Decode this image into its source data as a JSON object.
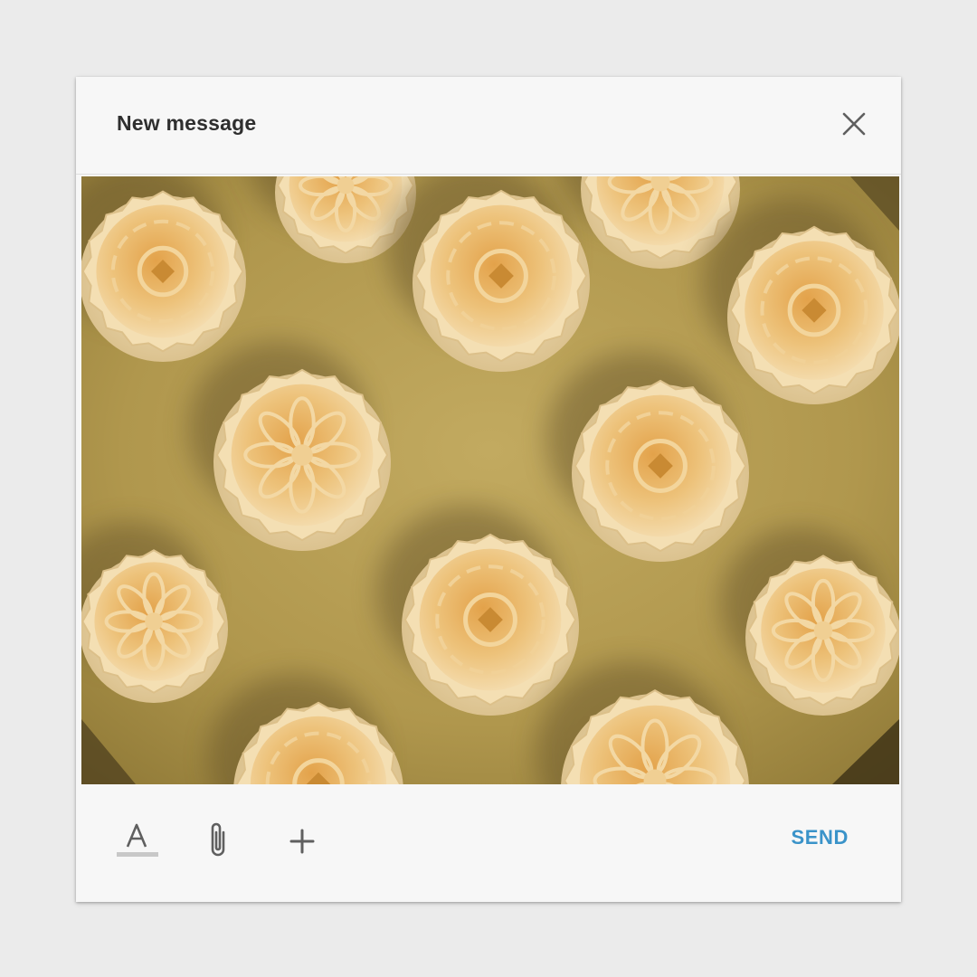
{
  "compose": {
    "title": "New message",
    "close_icon": "close-icon",
    "photo": {
      "subject": "mooncakes on a baking tray",
      "colors": {
        "tray": "#b39a4e",
        "pastry": "#eab867",
        "pastry_edge": "#f5dfb4",
        "shadow": "#5e4d26"
      }
    },
    "toolbar": {
      "format_icon": "text-format-icon",
      "attach_icon": "paperclip-icon",
      "add_icon": "plus-icon",
      "send_label": "SEND"
    },
    "colors": {
      "accent": "#3a93c9",
      "surface": "#f7f7f7",
      "backdrop": "#ebebeb"
    }
  }
}
